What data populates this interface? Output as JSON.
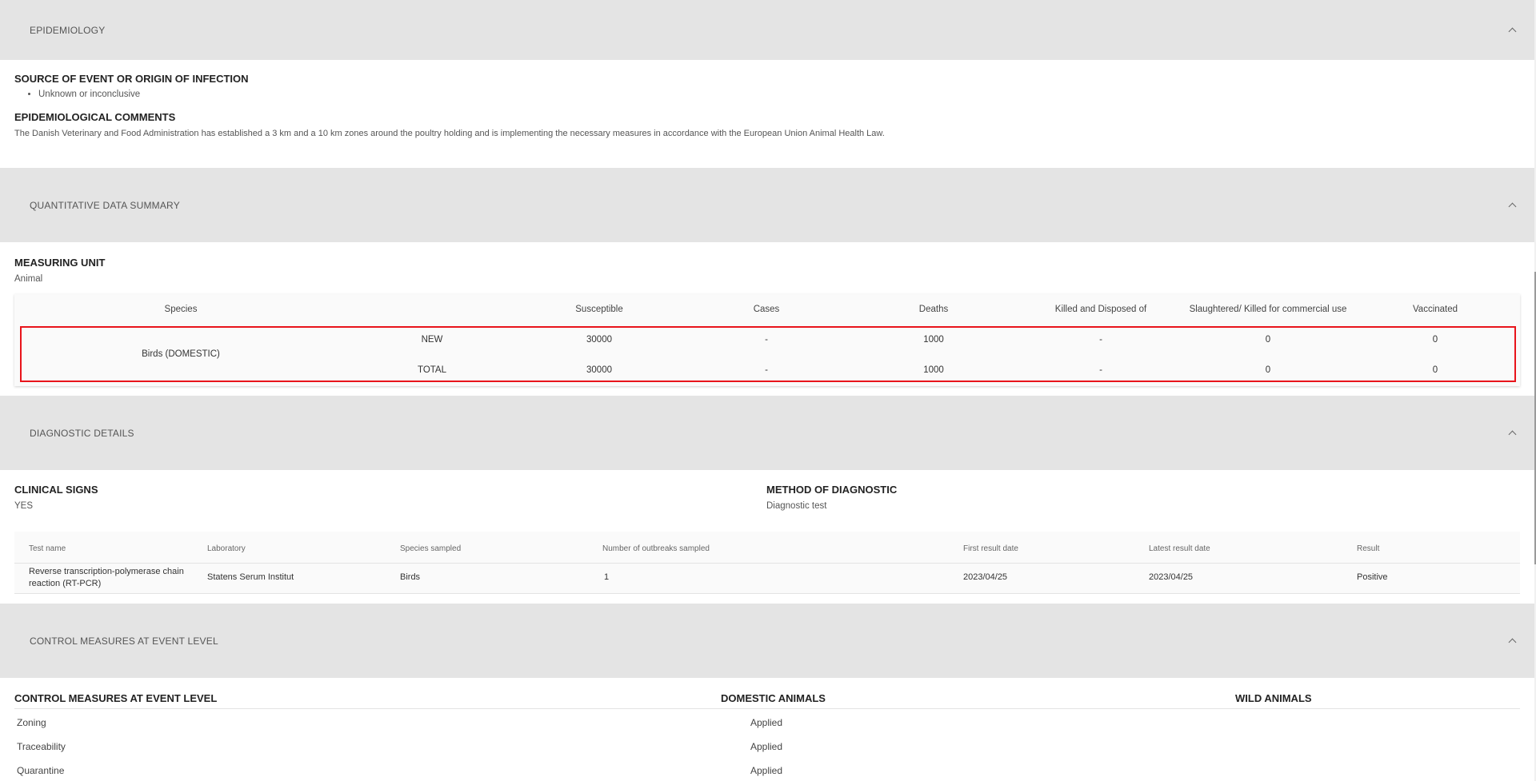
{
  "sections": {
    "epidemiology": "EPIDEMIOLOGY",
    "quantitative": "QUANTITATIVE DATA SUMMARY",
    "diagnostic": "DIAGNOSTIC DETAILS",
    "control": "CONTROL MEASURES AT EVENT LEVEL"
  },
  "epidemiology": {
    "source_label": "SOURCE OF EVENT OR ORIGIN OF INFECTION",
    "source_items": [
      "Unknown or inconclusive"
    ],
    "comments_label": "EPIDEMIOLOGICAL COMMENTS",
    "comments_text": "The Danish Veterinary and Food Administration has established a 3 km and a 10 km zones around the poultry holding and is implementing the necessary measures in accordance with the European Union Animal Health Law."
  },
  "quantitative": {
    "measuring_unit_label": "MEASURING UNIT",
    "measuring_unit_value": "Animal",
    "headers": {
      "species": "Species",
      "susceptible": "Susceptible",
      "cases": "Cases",
      "deaths": "Deaths",
      "killed": "Killed and Disposed of",
      "slaughtered": "Slaughtered/ Killed for commercial use",
      "vaccinated": "Vaccinated"
    },
    "species_name": "Birds (DOMESTIC)",
    "rows": [
      {
        "type": "NEW",
        "susceptible": "30000",
        "cases": "-",
        "deaths": "1000",
        "killed": "-",
        "slaughtered": "0",
        "vaccinated": "0"
      },
      {
        "type": "TOTAL",
        "susceptible": "30000",
        "cases": "-",
        "deaths": "1000",
        "killed": "-",
        "slaughtered": "0",
        "vaccinated": "0"
      }
    ]
  },
  "diagnostic": {
    "clinical_signs_label": "CLINICAL SIGNS",
    "clinical_signs_value": "YES",
    "method_label": "METHOD OF DIAGNOSTIC",
    "method_value": "Diagnostic test",
    "headers": {
      "test_name": "Test name",
      "laboratory": "Laboratory",
      "species_sampled": "Species sampled",
      "outbreaks_sampled": "Number of outbreaks sampled",
      "first_result": "First result date",
      "latest_result": "Latest result date",
      "result": "Result"
    },
    "row": {
      "test_name_line1": "Reverse transcription-polymerase chain",
      "test_name_line2": "reaction (RT-PCR)",
      "laboratory": "Statens Serum Institut",
      "species_sampled": "Birds",
      "outbreaks_sampled": "1",
      "first_result": "2023/04/25",
      "latest_result": "2023/04/25",
      "result": "Positive"
    }
  },
  "control": {
    "col_measures": "CONTROL MEASURES AT EVENT LEVEL",
    "col_domestic": "DOMESTIC ANIMALS",
    "col_wild": "WILD ANIMALS",
    "rows": [
      {
        "measure": "Zoning",
        "domestic": "Applied"
      },
      {
        "measure": "Traceability",
        "domestic": "Applied"
      },
      {
        "measure": "Quarantine",
        "domestic": "Applied"
      }
    ]
  },
  "icons": {
    "collapse": "chevron-up-icon"
  }
}
